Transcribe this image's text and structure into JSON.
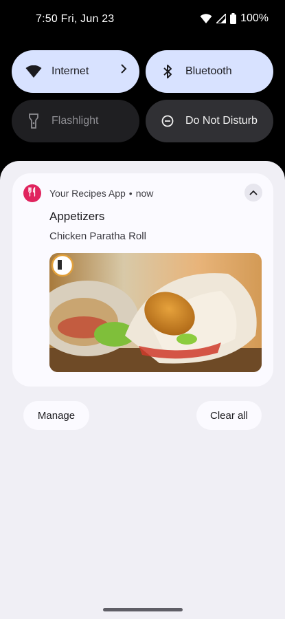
{
  "status_bar": {
    "time": "7:50",
    "date": "Fri, Jun 23",
    "battery": "100%",
    "icons": [
      "wifi-icon",
      "cell-signal-icon",
      "battery-icon"
    ]
  },
  "quick_settings": {
    "tiles": [
      {
        "label": "Internet",
        "icon": "wifi-icon",
        "state": "on"
      },
      {
        "label": "Bluetooth",
        "icon": "bluetooth-icon",
        "state": "on"
      },
      {
        "label": "Flashlight",
        "icon": "flashlight-icon",
        "state": "off"
      },
      {
        "label": "Do Not Disturb",
        "icon": "dnd-icon",
        "state": "off"
      }
    ]
  },
  "notification": {
    "app_name": "Your Recipes App",
    "separator": "•",
    "time": "now",
    "title": "Appetizers",
    "text": "Chicken Paratha Roll",
    "image": "chicken paratha roll photo",
    "app_color": "#e0245e"
  },
  "actions": {
    "manage": "Manage",
    "clear_all": "Clear all"
  },
  "colors": {
    "tile_active": "#d8e2ff",
    "tile_inactive": "#1f1f22",
    "shade_bg": "#f0eff5",
    "card_bg": "#fbfaff"
  }
}
